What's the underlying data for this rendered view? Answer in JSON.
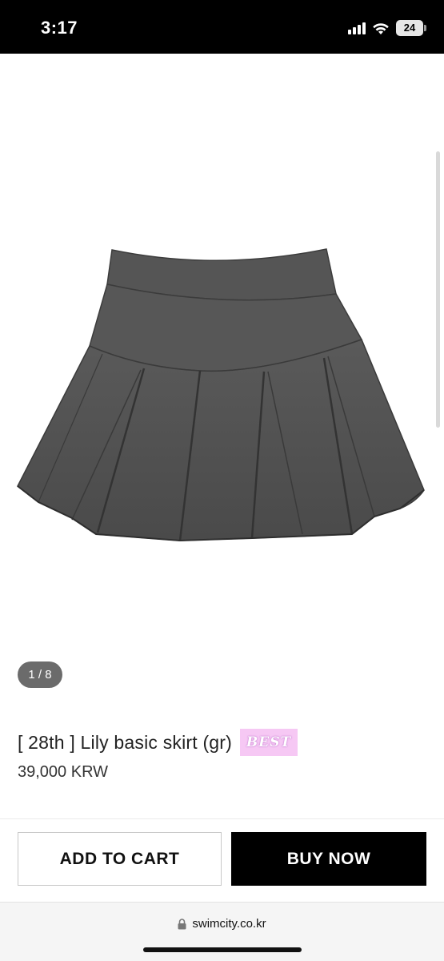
{
  "status_bar": {
    "time": "3:17",
    "battery_level": "24",
    "icons": [
      "signal-icon",
      "wifi-icon",
      "battery-icon"
    ]
  },
  "gallery": {
    "page_counter": "1 / 8",
    "current_image": 1,
    "total_images": 8,
    "image_subject": "gray pleated skirt"
  },
  "product": {
    "title": "[ 28th ] Lily basic skirt (gr)",
    "badge": "BEST",
    "badge_color": "#f6c8f4",
    "price": "39,000 KRW"
  },
  "actions": {
    "add_to_cart_label": "ADD TO CART",
    "buy_now_label": "BUY NOW"
  },
  "browser": {
    "url": "swimcity.co.kr",
    "url_icon": "lock-icon"
  }
}
